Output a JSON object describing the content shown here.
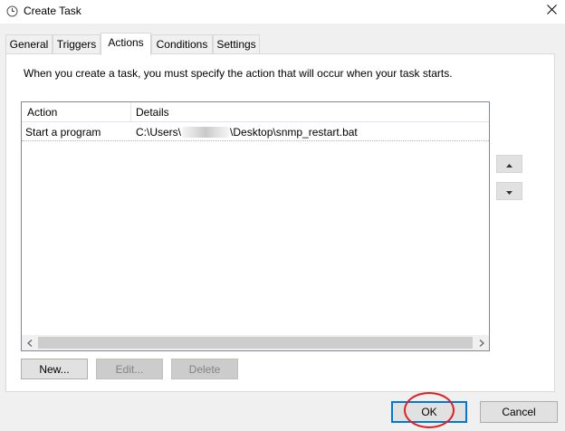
{
  "window": {
    "title": "Create Task",
    "icon": "clock-icon",
    "close_icon": "close-icon"
  },
  "tabs": [
    {
      "label": "General",
      "active": false
    },
    {
      "label": "Triggers",
      "active": false
    },
    {
      "label": "Actions",
      "active": true
    },
    {
      "label": "Conditions",
      "active": false
    },
    {
      "label": "Settings",
      "active": false
    }
  ],
  "actions_panel": {
    "description": "When you create a task, you must specify the action that will occur when your task starts.",
    "columns": [
      "Action",
      "Details"
    ],
    "rows": [
      {
        "action": "Start a program",
        "details_prefix": "C:\\Users\\",
        "details_suffix": "\\Desktop\\snmp_restart.bat"
      }
    ],
    "move_up_icon": "triangle-up-icon",
    "move_down_icon": "triangle-down-icon",
    "buttons": {
      "new": "New...",
      "edit": "Edit...",
      "delete": "Delete"
    }
  },
  "footer": {
    "ok": "OK",
    "cancel": "Cancel"
  },
  "annotation_color": "#e02020",
  "accent_color": "#0078d7"
}
